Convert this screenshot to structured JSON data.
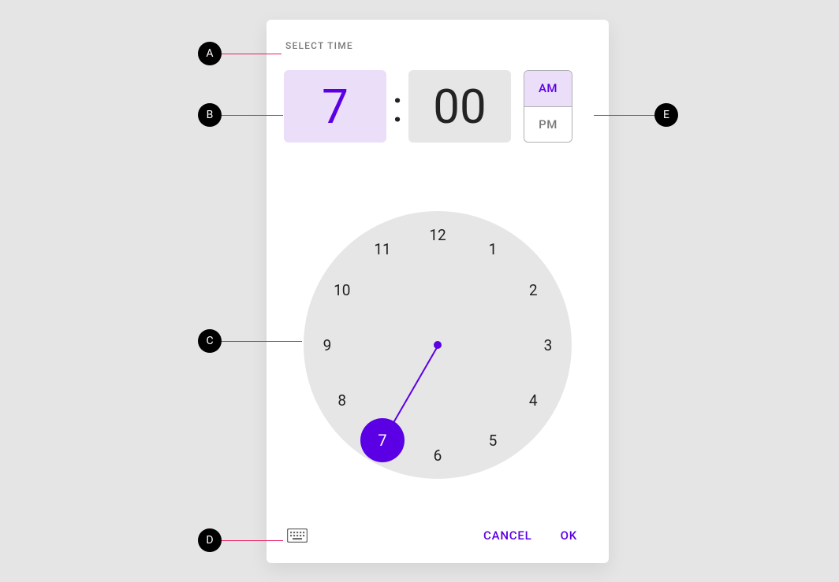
{
  "title": "SELECT TIME",
  "hour": "7",
  "minute": "00",
  "ampm": {
    "am": "AM",
    "pm": "PM",
    "selected": "AM"
  },
  "clock": {
    "numbers": [
      "12",
      "1",
      "2",
      "3",
      "4",
      "5",
      "6",
      "7",
      "8",
      "9",
      "10",
      "11"
    ],
    "selected": 7
  },
  "actions": {
    "cancel": "CANCEL",
    "ok": "OK"
  },
  "annotations": {
    "a": "A",
    "b": "B",
    "c": "C",
    "d": "D",
    "e": "E"
  }
}
